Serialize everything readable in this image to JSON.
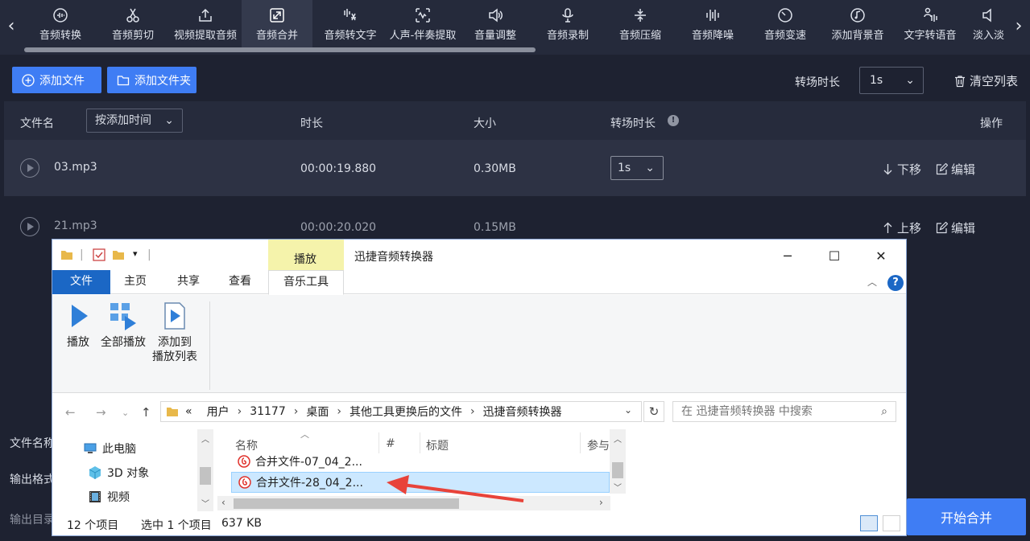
{
  "toolbar": {
    "items": [
      {
        "label": "音频转换",
        "icon": "audio-convert-icon"
      },
      {
        "label": "音频剪切",
        "icon": "scissors-icon"
      },
      {
        "label": "视频提取音频",
        "icon": "upload-icon"
      },
      {
        "label": "音频合并",
        "icon": "merge-icon"
      },
      {
        "label": "音频转文字",
        "icon": "speech-to-text-icon"
      },
      {
        "label": "人声-伴奏提取",
        "icon": "vocal-extract-icon"
      },
      {
        "label": "音量调整",
        "icon": "volume-icon"
      },
      {
        "label": "音频录制",
        "icon": "microphone-icon"
      },
      {
        "label": "音频压缩",
        "icon": "compress-icon"
      },
      {
        "label": "音频降噪",
        "icon": "denoise-icon"
      },
      {
        "label": "音频变速",
        "icon": "speed-icon"
      },
      {
        "label": "添加背景音",
        "icon": "background-music-icon"
      },
      {
        "label": "文字转语音",
        "icon": "text-to-speech-icon"
      },
      {
        "label": "淡入淡",
        "icon": "fade-icon"
      }
    ],
    "active": "音频合并"
  },
  "actions": {
    "add_file": "添加文件",
    "add_folder": "添加文件夹",
    "transition_label": "转场时长",
    "transition_value": "1s",
    "clear_list": "清空列表"
  },
  "table": {
    "headers": {
      "name": "文件名",
      "sort": "按添加时间",
      "duration": "时长",
      "size": "大小",
      "transition": "转场时长",
      "ops": "操作"
    },
    "rows": [
      {
        "name": "03.mp3",
        "duration": "00:00:19.880",
        "size": "0.30MB",
        "transition": "1s",
        "move": "下移",
        "edit": "编辑"
      },
      {
        "name": "21.mp3",
        "duration": "00:00:20.020",
        "size": "0.15MB",
        "move": "上移",
        "edit": "编辑"
      }
    ]
  },
  "bottom": {
    "file_name_label": "文件名称",
    "output_format_label": "输出格式",
    "output_dir_label": "输出目录",
    "start_merge": "开始合并"
  },
  "explorer": {
    "contextual_tab": "播放",
    "title": "迅捷音频转换器",
    "tabs": [
      "文件",
      "主页",
      "共享",
      "查看",
      "音乐工具"
    ],
    "ribbon": {
      "play": "播放",
      "play_all": "全部播放",
      "add_to_playlist_1": "添加到",
      "add_to_playlist_2": "播放列表"
    },
    "address": {
      "prefix": "«",
      "parts": [
        "用户",
        "31177",
        "桌面",
        "其他工具更换后的文件",
        "迅捷音频转换器"
      ]
    },
    "search_placeholder": "在 迅捷音频转换器 中搜索",
    "nav": [
      "此电脑",
      "3D 对象",
      "视频"
    ],
    "columns": [
      "名称",
      "#",
      "标题",
      "参与"
    ],
    "files": [
      {
        "name": "合并文件-07_04_2..."
      },
      {
        "name": "合并文件-28_04_2..."
      }
    ],
    "status": {
      "count": "12 个项目",
      "selected": "选中 1 个项目",
      "size": "637 KB"
    }
  },
  "colors": {
    "accent": "#3f7df4",
    "app_bg": "#1e2231",
    "toolbar_bg": "#252a3b",
    "annotation": "#e8433a",
    "file_tab": "#1b67c5"
  }
}
